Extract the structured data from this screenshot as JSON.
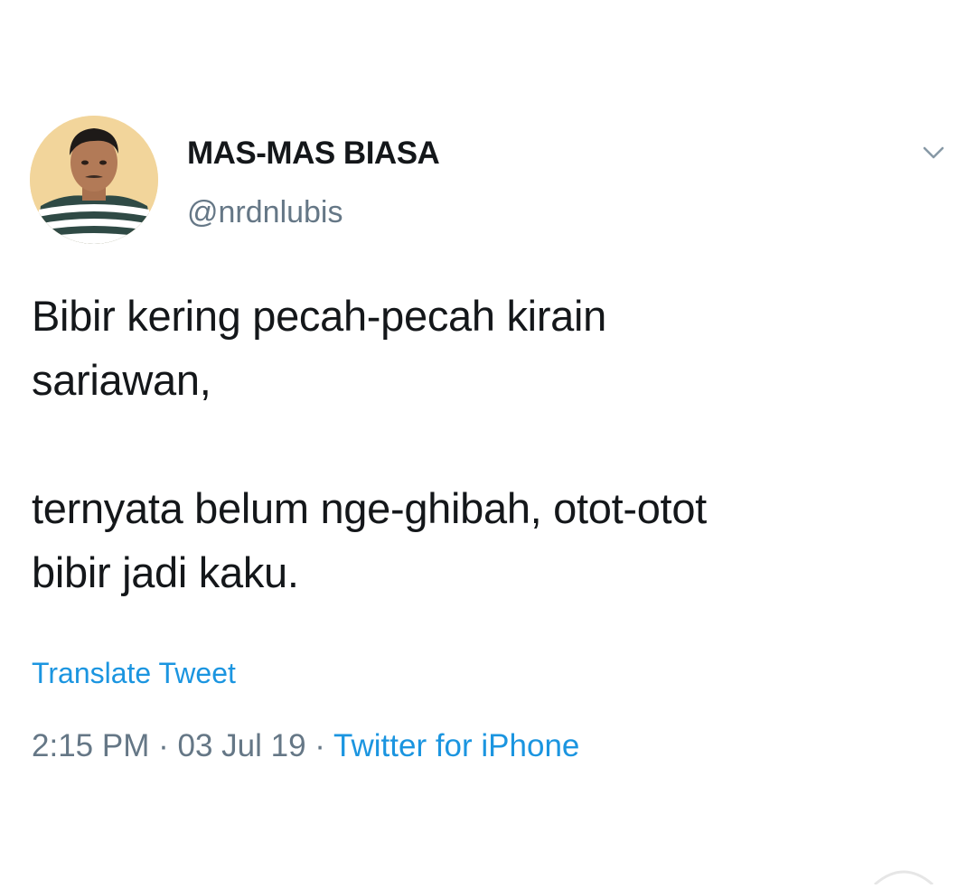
{
  "tweet": {
    "display_name": "MAS-MAS BIASA",
    "handle": "@nrdnlubis",
    "text_line_1": "Bibir kering pecah-pecah kirain",
    "text_line_2": "sariawan,",
    "text_line_3": "ternyata belum nge-ghibah, otot-otot",
    "text_line_4": "bibir jadi kaku.",
    "translate_label": "Translate Tweet",
    "time": "2:15 PM",
    "separator": "·",
    "date": "03 Jul 19",
    "source": "Twitter for iPhone"
  },
  "icons": {
    "menu": "chevron-down-icon",
    "avatar": "profile-photo"
  },
  "colors": {
    "text": "#14171a",
    "muted": "#657786",
    "link": "#1b95e0",
    "background": "#ffffff"
  }
}
